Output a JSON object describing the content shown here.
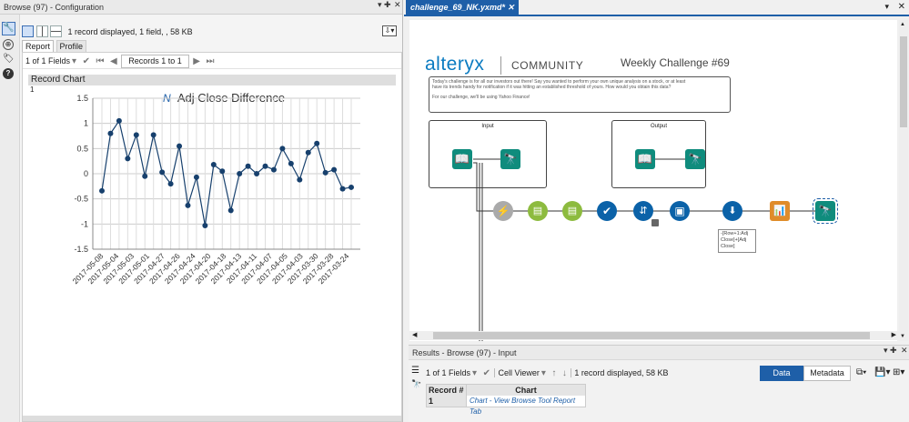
{
  "left_panel": {
    "title": "Browse (97) - Configuration",
    "info": "1 record displayed, 1 field, , 58 KB",
    "tabs": [
      "Report",
      "Profile"
    ],
    "fields_dropdown": "1 of 1 Fields",
    "records_label": "Records 1 to 1",
    "section_title": "Record Chart",
    "record_number": "1"
  },
  "chart_data": {
    "type": "line",
    "title": "Adj Close Difference",
    "ylim": [
      -1.5,
      1.5
    ],
    "yticks": [
      "1.5",
      "1",
      "0.5",
      "0",
      "-0.5",
      "-1",
      "-1.5"
    ],
    "grid": true,
    "values": [
      -0.34,
      0.8,
      1.05,
      0.3,
      0.77,
      -0.05,
      0.77,
      0.03,
      -0.2,
      0.55,
      -0.63,
      -0.07,
      -1.03,
      0.18,
      0.05,
      -0.73,
      0.0,
      0.15,
      0.0,
      0.15,
      0.08,
      0.5,
      0.2,
      -0.12,
      0.42,
      0.6,
      0.02,
      0.08,
      -0.3,
      -0.27
    ],
    "xlabels": [
      "2017-05-08",
      "2017-05-04",
      "2017-05-03",
      "2017-05-01",
      "2017-04-27",
      "2017-04-26",
      "2017-04-24",
      "2017-04-20",
      "2017-04-18",
      "2017-04-13",
      "2017-04-11",
      "2017-04-07",
      "2017-04-05",
      "2017-04-03",
      "2017-03-30",
      "2017-03-28",
      "2017-03-24"
    ],
    "line_color": "#17406d"
  },
  "doc_tab": "challenge_69_NK.yxmd*",
  "canvas": {
    "brand": "alteryx",
    "brand_suffix": "COMMUNITY",
    "challenge_title": "Weekly Challenge #69",
    "description": [
      "Today's challenge is for all our investors out there! Say you wanted to perform your own unique analysis on a stock, or at least",
      "have its trends handy for notification if it was hitting an established threshold of yours. How would you obtain this data?",
      "",
      "For our challenge, we'll be using Yahoo Finance!"
    ],
    "input_label": "Input",
    "output_label": "Output",
    "formula_annotation": [
      "-[Row+1:Adj",
      "Close]+[Adj",
      "Close]"
    ]
  },
  "results": {
    "title": "Results - Browse (97) - Input",
    "fields_dropdown": "1 of 1 Fields",
    "viewer": "Cell Viewer",
    "info": "1 record displayed, 58 KB",
    "data_btn": "Data",
    "metadata_btn": "Metadata",
    "col_record": "Record #",
    "col_chart": "Chart",
    "row_num": "1",
    "row_value": "Chart - View Browse Tool Report Tab"
  },
  "colors": {
    "accent": "#1e5fa8",
    "alteryx_blue": "#0b7bc1",
    "tool_teal": "#0f8c7d",
    "tool_green": "#5fa83a"
  }
}
